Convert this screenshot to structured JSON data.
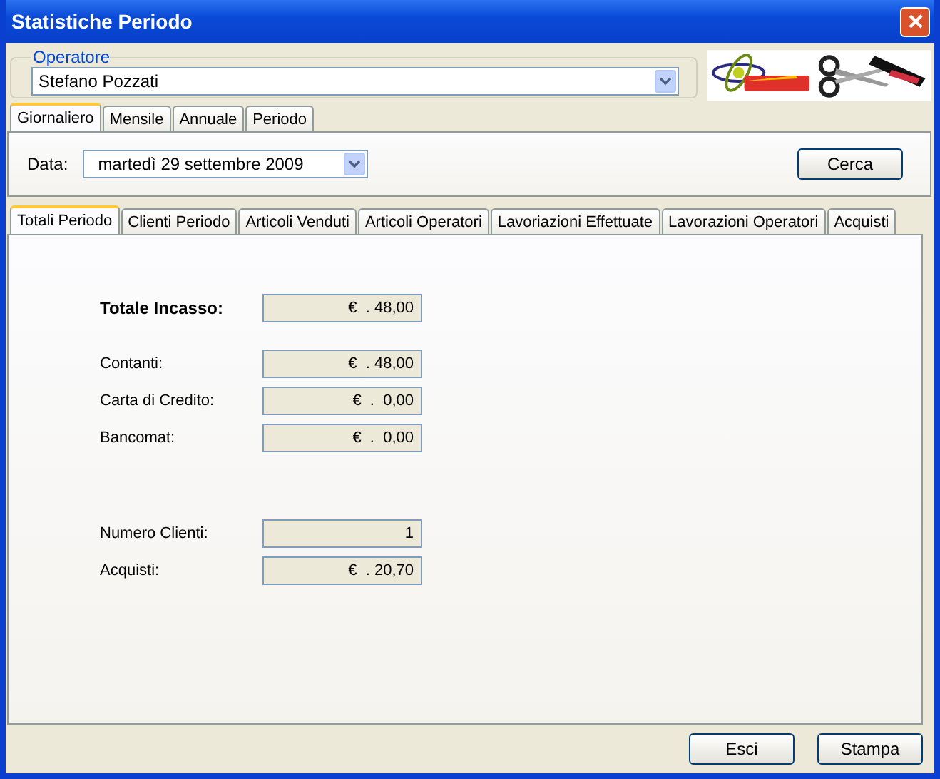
{
  "window": {
    "title": "Statistiche Periodo"
  },
  "operator": {
    "legend": "Operatore",
    "value": "Stefano Pozzati"
  },
  "period_tabs": [
    {
      "label": "Giornaliero",
      "selected": true
    },
    {
      "label": "Mensile",
      "selected": false
    },
    {
      "label": "Annuale",
      "selected": false
    },
    {
      "label": "Periodo",
      "selected": false
    }
  ],
  "date": {
    "label": "Data:",
    "value": "martedì   29 settembre  2009"
  },
  "search_button": "Cerca",
  "tabs": [
    {
      "label": "Totali Periodo",
      "selected": true
    },
    {
      "label": "Clienti Periodo",
      "selected": false
    },
    {
      "label": "Articoli Venduti",
      "selected": false
    },
    {
      "label": "Articoli Operatori",
      "selected": false
    },
    {
      "label": "Lavoriazioni Effettuate",
      "selected": false
    },
    {
      "label": "Lavorazioni Operatori",
      "selected": false
    },
    {
      "label": "Acquisti",
      "selected": false
    }
  ],
  "groups": [
    [
      {
        "label": "Totale Incasso:",
        "value": "€  . 48,00",
        "kind": "total"
      }
    ],
    [
      {
        "label": "Contanti:",
        "value": "€  . 48,00",
        "kind": "normal"
      },
      {
        "label": "Carta di Credito:",
        "value": "€  .  0,00",
        "kind": "normal"
      },
      {
        "label": "Bancomat:",
        "value": "€  .  0,00",
        "kind": "normal"
      }
    ],
    [
      {
        "label": "Numero Clienti:",
        "value": "1",
        "kind": "normal"
      },
      {
        "label": "Acquisti:",
        "value": "€  . 20,70",
        "kind": "normal"
      }
    ]
  ],
  "buttons": [
    "Esci",
    "Stampa"
  ]
}
